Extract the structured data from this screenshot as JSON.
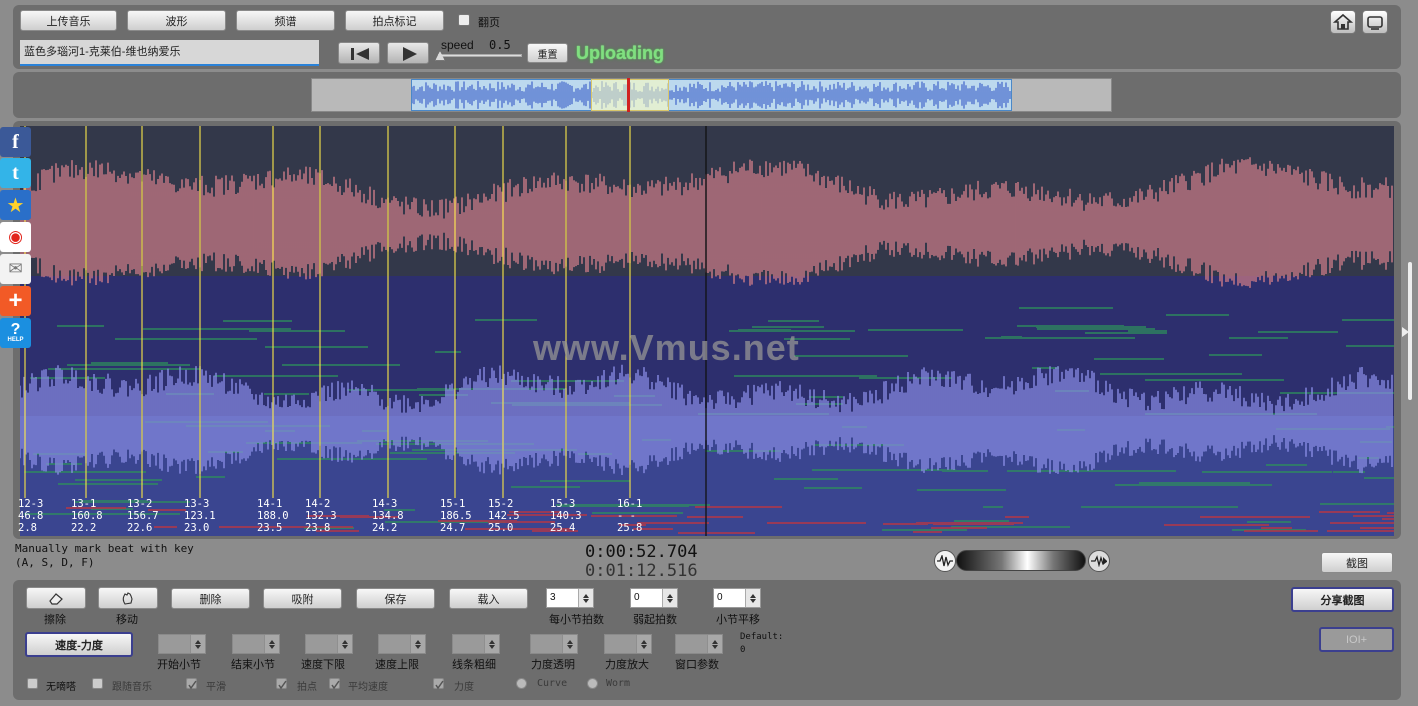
{
  "toolbar": {
    "upload_label": "上传音乐",
    "waveform_label": "波形",
    "spectrum_label": "频谱",
    "beatmark_label": "拍点标记",
    "page_turn_label": "翻页",
    "song_title": "蓝色多瑙河1-克莱伯-维也纳爱乐",
    "speed_label": "speed",
    "speed_value": "0.5",
    "reset_label": "重置",
    "status": "Uploading"
  },
  "spectrogram": {
    "watermark": "www.Vmus.net",
    "beats": [
      {
        "measure": "12-3",
        "tempo": "46.8",
        "time": "2.8"
      },
      {
        "measure": "13-1",
        "tempo": "160.8",
        "time": "22.2"
      },
      {
        "measure": "13-2",
        "tempo": "156.7",
        "time": "22.6"
      },
      {
        "measure": "13-3",
        "tempo": "123.1",
        "time": "23.0"
      },
      {
        "measure": "14-1",
        "tempo": "188.0",
        "time": "23.5"
      },
      {
        "measure": "14-2",
        "tempo": "132.3",
        "time": "23.8"
      },
      {
        "measure": "14-3",
        "tempo": "134.8",
        "time": "24.2"
      },
      {
        "measure": "15-1",
        "tempo": "186.5",
        "time": "24.7"
      },
      {
        "measure": "15-2",
        "tempo": "142.5",
        "time": "25.0"
      },
      {
        "measure": "15-3",
        "tempo": "140.3",
        "time": "25.4"
      },
      {
        "measure": "16-1",
        "tempo": "- -",
        "time": "25.8"
      }
    ]
  },
  "status": {
    "hint_line1": "Manually mark beat with key",
    "hint_line2": "(A, S, D, F)",
    "current_time": "0:00:52.704",
    "total_time": "0:01:12.516",
    "screenshot_label": "截图"
  },
  "social": [
    "facebook",
    "twitter",
    "favorite",
    "weibo",
    "email",
    "add",
    "help"
  ],
  "social_help_text": "HELP",
  "edit": {
    "erase_label": "擦除",
    "move_label": "移动",
    "delete_label": "删除",
    "snap_label": "吸附",
    "save_label": "保存",
    "load_label": "载入",
    "beats_per_measure_value": "3",
    "beats_per_measure_label": "每小节拍数",
    "pickup_beats_value": "0",
    "pickup_beats_label": "弱起拍数",
    "measure_offset_value": "0",
    "measure_offset_label": "小节平移",
    "share_label": "分享截图",
    "tempo_dynamic_label": "速度-力度",
    "disabled_button_label": "IOI+",
    "start_measure_label": "开始小节",
    "end_measure_label": "结束小节",
    "tempo_min_label": "速度下限",
    "tempo_max_label": "速度上限",
    "line_thickness_label": "线条粗细",
    "dynamic_transparency_label": "力度透明",
    "dynamic_zoom_label": "力度放大",
    "window_param_label": "窗口参数",
    "default_label": "Default:",
    "default_value": "0"
  },
  "options": {
    "no_tick": "无嘀嗒",
    "follow_music": "跟随音乐",
    "smooth": "平滑",
    "beats": "拍点",
    "avg_tempo": "平均速度",
    "dynamics": "力度",
    "curve": "Curve",
    "worm": "Worm"
  }
}
